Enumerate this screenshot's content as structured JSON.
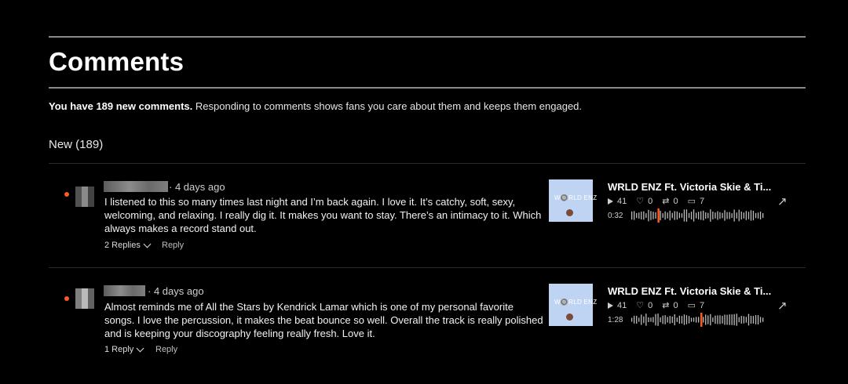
{
  "page": {
    "title": "Comments",
    "summary_bold": "You have 189 new comments.",
    "summary_rest": " Responding to comments shows fans you care about them and keeps them engaged.",
    "section_label": "New (189)"
  },
  "comments": [
    {
      "time": "· 4 days ago",
      "body": "I listened to this so many times last night and I’m back again. I love it. It’s catchy, soft, sexy, welcoming, and relaxing. I really dig it. It makes you want to stay. There’s an intimacy to it. Which always makes a record stand out.",
      "replies_label": "2 Replies",
      "reply_label": "Reply",
      "track": {
        "thumb_logo": "W🔘RLD ENZ",
        "title": "WRLD ENZ Ft. Victoria Skie & Ti...",
        "plays": "41",
        "likes": "0",
        "reposts": "0",
        "comments": "7",
        "position": "0:32",
        "progress": 0.2
      }
    },
    {
      "time": "· 4 days ago",
      "body": "Almost reminds me of All the Stars by Kendrick Lamar which is one of my personal favorite songs. I love the percussion, it makes the beat bounce so well. Overall the track is really polished and is keeping your discography feeling really fresh. Love it.",
      "replies_label": "1 Reply",
      "reply_label": "Reply",
      "track": {
        "thumb_logo": "W🔘RLD ENZ",
        "title": "WRLD ENZ Ft. Victoria Skie & Ti...",
        "plays": "41",
        "likes": "0",
        "reposts": "0",
        "comments": "7",
        "position": "1:28",
        "progress": 0.52
      }
    }
  ],
  "icons": {
    "play": "play-icon",
    "like": "heart-icon",
    "repost": "repost-icon",
    "comment": "comment-icon",
    "open": "external-link-icon"
  },
  "colors": {
    "accent": "#ff5a1f",
    "background": "#000000",
    "thumb": "#bfd4f2"
  }
}
